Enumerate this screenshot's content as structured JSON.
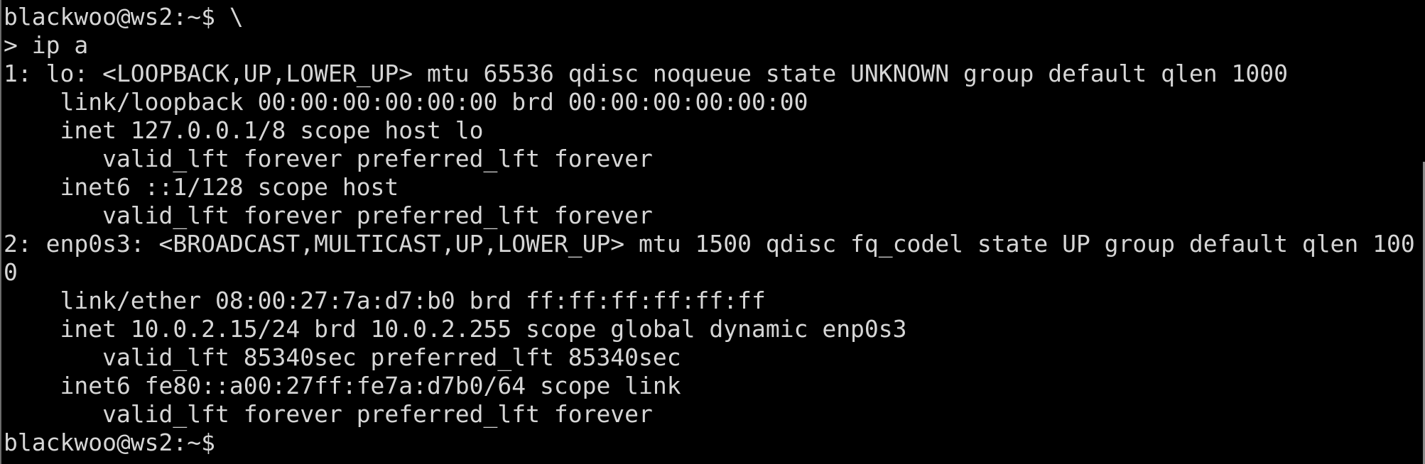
{
  "terminal": {
    "lines": [
      "blackwoo@ws2:~$ \\",
      "> ip a",
      "1: lo: <LOOPBACK,UP,LOWER_UP> mtu 65536 qdisc noqueue state UNKNOWN group default qlen 1000",
      "    link/loopback 00:00:00:00:00:00 brd 00:00:00:00:00:00",
      "    inet 127.0.0.1/8 scope host lo",
      "       valid_lft forever preferred_lft forever",
      "    inet6 ::1/128 scope host",
      "       valid_lft forever preferred_lft forever",
      "2: enp0s3: <BROADCAST,MULTICAST,UP,LOWER_UP> mtu 1500 qdisc fq_codel state UP group default qlen 100",
      "0",
      "    link/ether 08:00:27:7a:d7:b0 brd ff:ff:ff:ff:ff:ff",
      "    inet 10.0.2.15/24 brd 10.0.2.255 scope global dynamic enp0s3",
      "       valid_lft 85340sec preferred_lft 85340sec",
      "    inet6 fe80::a00:27ff:fe7a:d7b0/64 scope link",
      "       valid_lft forever preferred_lft forever",
      "blackwoo@ws2:~$"
    ]
  }
}
